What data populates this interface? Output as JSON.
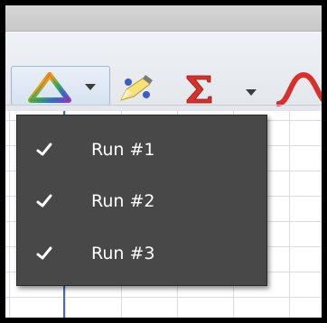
{
  "toolbar": {
    "run_selector_icon": "rainbow-triangle-icon",
    "run_dropdown_icon": "chevron-down-icon",
    "pencil_icon": "pencil-icon",
    "sigma_icon": "sigma-icon",
    "sigma_dropdown_icon": "chevron-down-icon",
    "curve_icon": "curve-fit-icon"
  },
  "runs_menu": {
    "items": [
      {
        "label": "Run #1",
        "checked": true,
        "check_icon": "checkmark-icon"
      },
      {
        "label": "Run #2",
        "checked": true,
        "check_icon": "checkmark-icon"
      },
      {
        "label": "Run #3",
        "checked": true,
        "check_icon": "checkmark-icon"
      }
    ]
  },
  "colors": {
    "menu_background": "#484848",
    "menu_text": "#ffffff",
    "toolbar_background": "#e6eaef",
    "frame_border": "#000000",
    "grid_lines": "#d9dde3",
    "accent_blue": "#4a6aa8"
  }
}
